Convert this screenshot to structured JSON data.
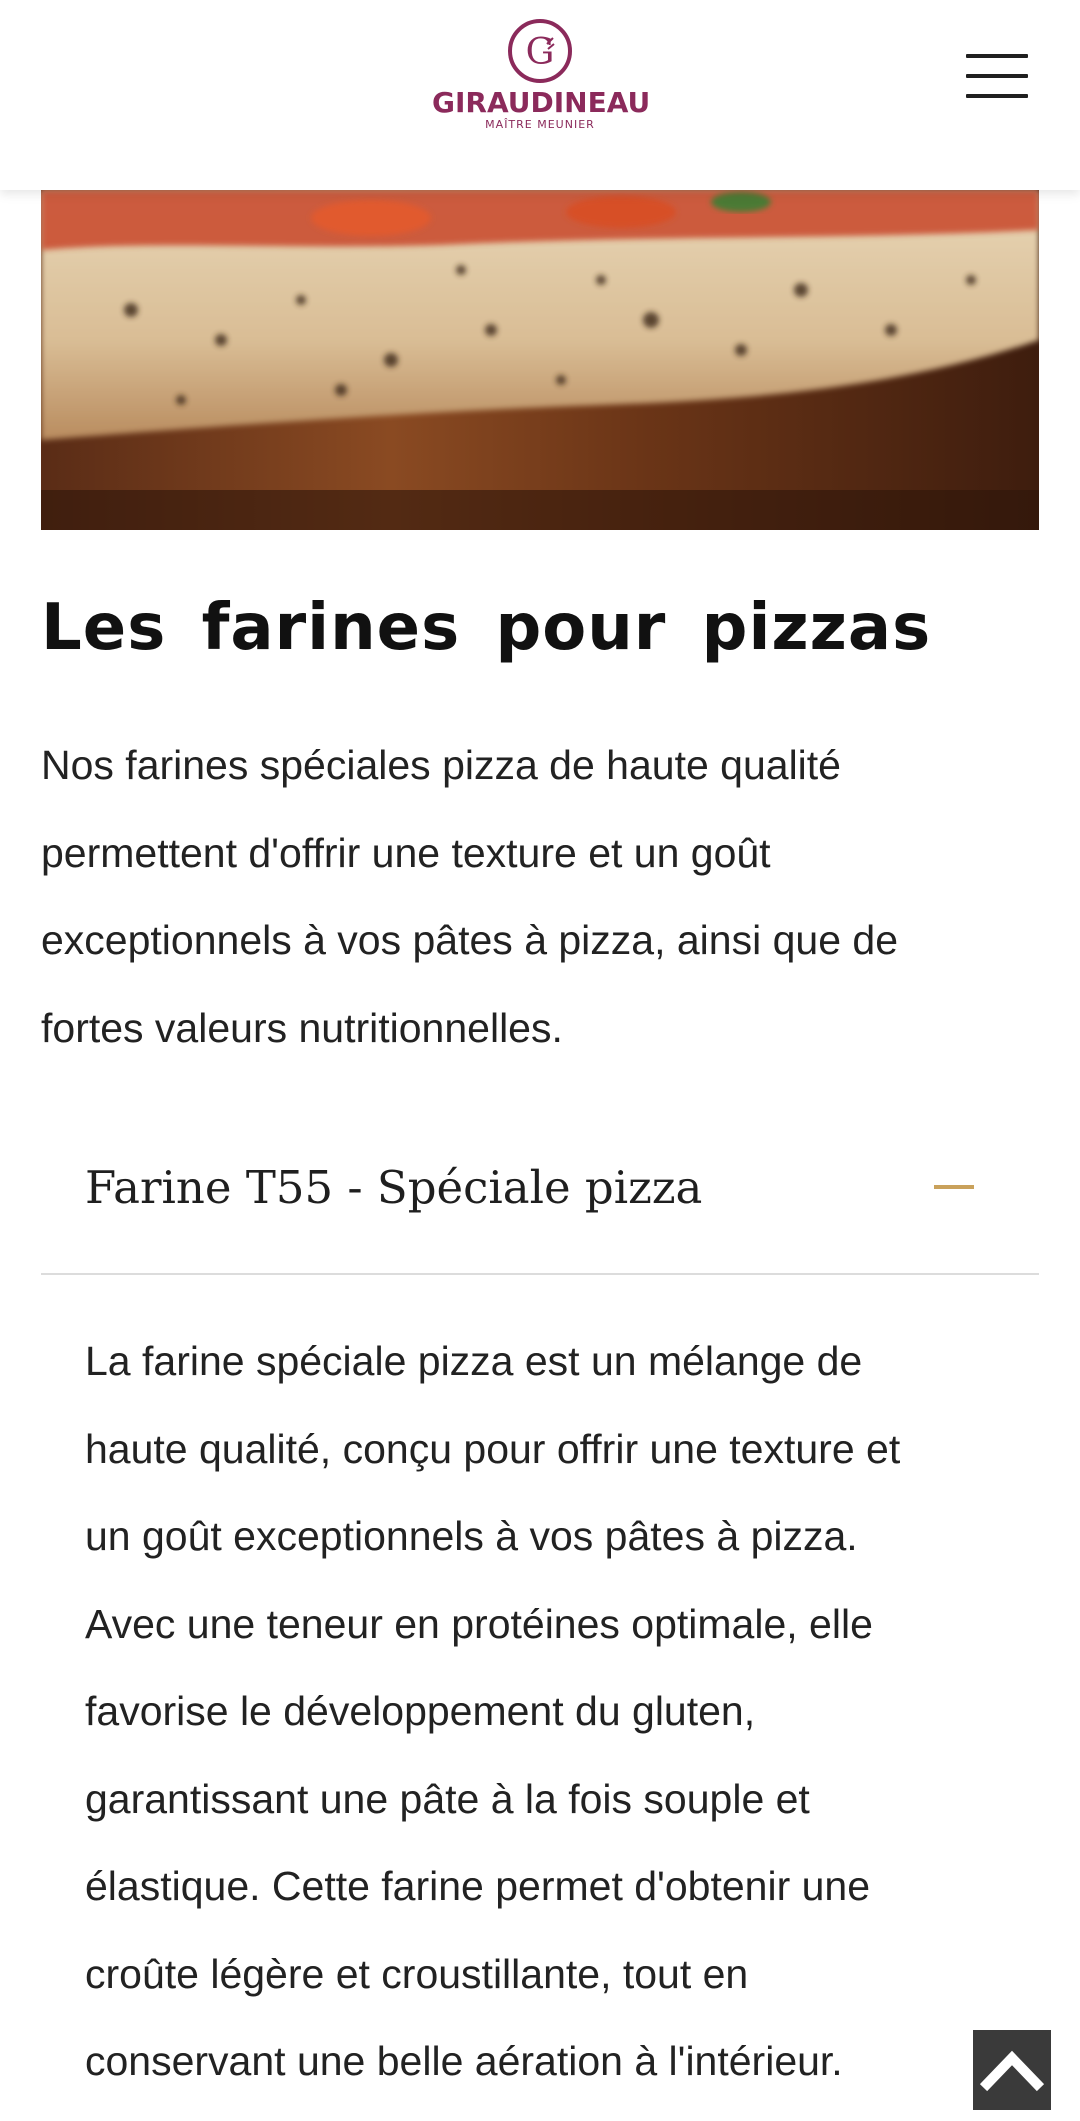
{
  "header": {
    "brand_name": "GIRAUDINEAU",
    "brand_tagline": "MAÎTRE MEUNIER",
    "logo_letter": "G",
    "brand_color": "#8b2a5b",
    "menu_icon": "hamburger-menu-icon"
  },
  "hero": {
    "image_subject": "pizza"
  },
  "section": {
    "title": "Les farines pour pizzas",
    "intro_lines": [
      "Nos farines spéciales pizza de haute qualité",
      "permettent d'offrir une texture et un goût",
      "exceptionnels à vos pâtes à pizza, ainsi que de",
      "fortes valeurs nutritionnelles."
    ]
  },
  "accordion": {
    "item_title": "Farine T55 - Spéciale pizza",
    "toggle_icon": "minus-icon",
    "toggle_color": "#c9a15b",
    "expanded": true,
    "body_lines": [
      "La farine spéciale pizza est un mélange de",
      "haute qualité, conçu pour offrir une texture et",
      "un goût exceptionnels à vos pâtes à pizza.",
      "Avec une teneur en protéines optimale, elle",
      "favorise le développement du gluten,",
      "garantissant une pâte à la fois souple et",
      "élastique. Cette farine permet d'obtenir une",
      "croûte légère et croustillante, tout en",
      "conservant une belle aération à l'intérieur."
    ]
  },
  "scroll_top": {
    "icon": "chevron-up-icon"
  }
}
